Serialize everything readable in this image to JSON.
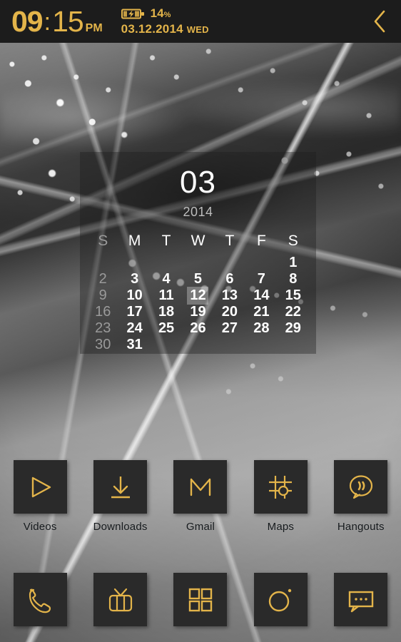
{
  "theme": {
    "accent_gold": "#e3b44a",
    "tile_bg": "#2a2a2a",
    "statusbar_bg": "#1c1c1c",
    "widget_text": "#ffffff"
  },
  "statusbar": {
    "time_hour": "09",
    "time_colon": ":",
    "time_minute": "15",
    "time_meridiem": "PM",
    "battery_icon": "battery-charging-icon",
    "battery_percent": "14",
    "battery_percent_unit": "%",
    "date": "03.12.2014",
    "day_of_week": "WED",
    "back_icon": "chevron-left-icon"
  },
  "calendar_widget": {
    "month": "03",
    "year": "2014",
    "weekday_headers": [
      "S",
      "M",
      "T",
      "W",
      "T",
      "F",
      "S"
    ],
    "today": "12",
    "weeks": [
      [
        "",
        "",
        "",
        "",
        "",
        "",
        "1"
      ],
      [
        "2",
        "3",
        "4",
        "5",
        "6",
        "7",
        "8"
      ],
      [
        "9",
        "10",
        "11",
        "12",
        "13",
        "14",
        "15"
      ],
      [
        "16",
        "17",
        "18",
        "19",
        "20",
        "21",
        "22"
      ],
      [
        "23",
        "24",
        "25",
        "26",
        "27",
        "28",
        "29"
      ],
      [
        "30",
        "31",
        "",
        "",
        "",
        "",
        ""
      ]
    ]
  },
  "apps": [
    {
      "label": "Videos",
      "icon": "play-triangle-icon"
    },
    {
      "label": "Downloads",
      "icon": "download-arrow-icon"
    },
    {
      "label": "Gmail",
      "icon": "envelope-m-icon"
    },
    {
      "label": "Maps",
      "icon": "map-grid-pin-icon"
    },
    {
      "label": "Hangouts",
      "icon": "speech-bubble-quote-icon"
    }
  ],
  "dock": [
    {
      "name": "Phone",
      "icon": "phone-handset-icon"
    },
    {
      "name": "TV",
      "icon": "retro-tv-icon"
    },
    {
      "name": "App Drawer",
      "icon": "four-squares-icon"
    },
    {
      "name": "Camera",
      "icon": "camera-lens-icon"
    },
    {
      "name": "Messages",
      "icon": "message-dots-icon"
    }
  ]
}
